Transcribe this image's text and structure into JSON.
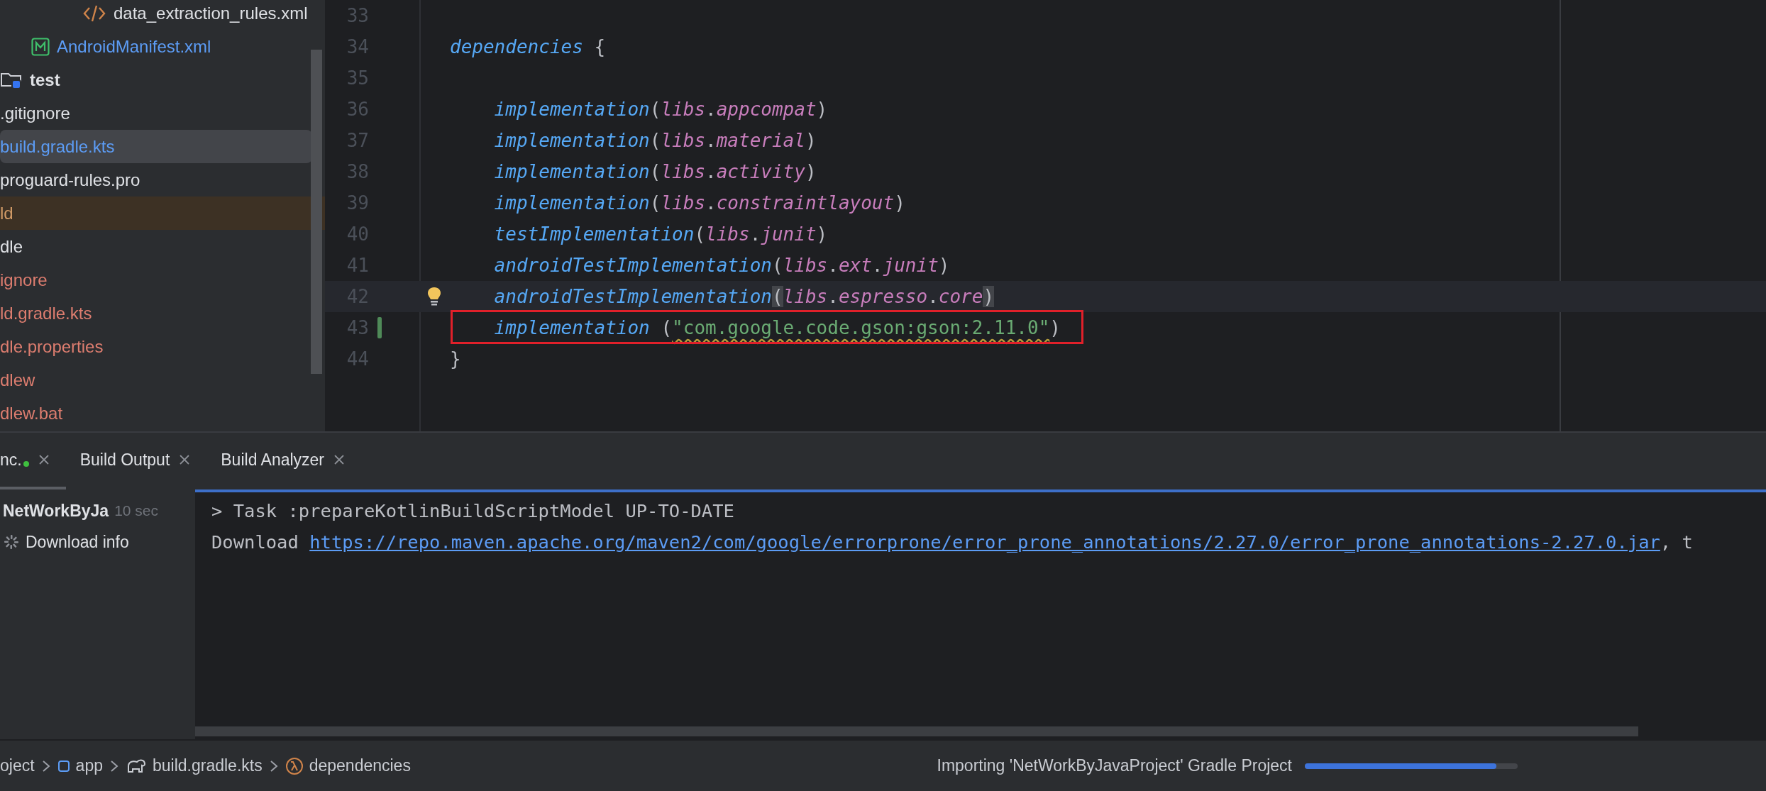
{
  "project_tree": [
    {
      "children": [
        {
          "children": [
            {
              "children": [
                {
                  "label": "data_extraction_rules.xml",
                  "kind": "xml",
                  "color": "#dfe1e5",
                  "selected": false,
                  "highlighted": false
                }
              ]
            },
            {
              "label": "AndroidManifest.xml",
              "kind": "manifest",
              "color": "#5c9cf5",
              "selected": false,
              "highlighted": false
            }
          ]
        },
        {
          "label": "test",
          "kind": "folder",
          "color": "#dfe1e5",
          "selected": false,
          "highlighted": false
        },
        {
          "label": ".gitignore",
          "color": "#dfe1e5",
          "selected": false,
          "highlighted": false
        },
        {
          "label": "build.gradle.kts",
          "color": "#5c9cf5",
          "selected": true,
          "highlighted": false
        },
        {
          "label": "proguard-rules.pro",
          "color": "#dfe1e5",
          "selected": false,
          "highlighted": false
        }
      ]
    },
    {
      "label": "ld",
      "color": "#d19a66",
      "selected": false,
      "highlighted": true
    },
    {
      "label": "dle",
      "color": "#dfe1e5",
      "selected": false,
      "highlighted": false
    },
    {
      "label": "ignore",
      "color": "#dd7d6f",
      "selected": false,
      "highlighted": false
    },
    {
      "label": "ld.gradle.kts",
      "color": "#dd7d6f",
      "selected": false,
      "highlighted": false
    },
    {
      "label": "dle.properties",
      "color": "#dd7d6f",
      "selected": false,
      "highlighted": false
    },
    {
      "label": "dlew",
      "color": "#dd7d6f",
      "selected": false,
      "highlighted": false
    },
    {
      "label": "dlew.bat",
      "color": "#dd7d6f",
      "selected": false,
      "highlighted": false
    }
  ],
  "editor": {
    "lines": [
      {
        "number": "33",
        "current": false,
        "changed": false,
        "bulb": false,
        "annotated": false
      },
      {
        "number": "34",
        "current": false,
        "changed": false,
        "bulb": false,
        "annotated": false,
        "tokens": [
          {
            "kind": "fn",
            "text": "dependencies"
          },
          {
            "kind": "plain",
            "text": " {"
          }
        ]
      },
      {
        "number": "35",
        "current": false,
        "changed": false,
        "bulb": false,
        "annotated": false
      },
      {
        "number": "36",
        "current": false,
        "changed": false,
        "bulb": false,
        "annotated": false,
        "tokens": [
          {
            "kind": "fn",
            "text": "    implementation"
          },
          {
            "kind": "plain",
            "text": "("
          },
          {
            "kind": "lib",
            "text": "libs"
          },
          {
            "kind": "plain",
            "text": "."
          },
          {
            "kind": "lib",
            "text": "appcompat"
          },
          {
            "kind": "plain",
            "text": ")"
          }
        ]
      },
      {
        "number": "37",
        "current": false,
        "changed": false,
        "bulb": false,
        "annotated": false,
        "tokens": [
          {
            "kind": "fn",
            "text": "    implementation"
          },
          {
            "kind": "plain",
            "text": "("
          },
          {
            "kind": "lib",
            "text": "libs"
          },
          {
            "kind": "plain",
            "text": "."
          },
          {
            "kind": "lib",
            "text": "material"
          },
          {
            "kind": "plain",
            "text": ")"
          }
        ]
      },
      {
        "number": "38",
        "current": false,
        "changed": false,
        "bulb": false,
        "annotated": false,
        "tokens": [
          {
            "kind": "fn",
            "text": "    implementation"
          },
          {
            "kind": "plain",
            "text": "("
          },
          {
            "kind": "lib",
            "text": "libs"
          },
          {
            "kind": "plain",
            "text": "."
          },
          {
            "kind": "lib",
            "text": "activity"
          },
          {
            "kind": "plain",
            "text": ")"
          }
        ]
      },
      {
        "number": "39",
        "current": false,
        "changed": false,
        "bulb": false,
        "annotated": false,
        "tokens": [
          {
            "kind": "fn",
            "text": "    implementation"
          },
          {
            "kind": "plain",
            "text": "("
          },
          {
            "kind": "lib",
            "text": "libs"
          },
          {
            "kind": "plain",
            "text": "."
          },
          {
            "kind": "lib",
            "text": "constraintlayout"
          },
          {
            "kind": "plain",
            "text": ")"
          }
        ]
      },
      {
        "number": "40",
        "current": false,
        "changed": false,
        "bulb": false,
        "annotated": false,
        "tokens": [
          {
            "kind": "fn",
            "text": "    testImplementation"
          },
          {
            "kind": "plain",
            "text": "("
          },
          {
            "kind": "lib",
            "text": "libs"
          },
          {
            "kind": "plain",
            "text": "."
          },
          {
            "kind": "lib",
            "text": "junit"
          },
          {
            "kind": "plain",
            "text": ")"
          }
        ]
      },
      {
        "number": "41",
        "current": false,
        "changed": false,
        "bulb": false,
        "annotated": false,
        "tokens": [
          {
            "kind": "fn",
            "text": "    androidTestImplementation"
          },
          {
            "kind": "plain",
            "text": "("
          },
          {
            "kind": "lib",
            "text": "libs"
          },
          {
            "kind": "plain",
            "text": "."
          },
          {
            "kind": "lib",
            "text": "ext"
          },
          {
            "kind": "plain",
            "text": "."
          },
          {
            "kind": "lib",
            "text": "junit"
          },
          {
            "kind": "plain",
            "text": ")"
          }
        ]
      },
      {
        "number": "42",
        "current": true,
        "changed": false,
        "bulb": true,
        "annotated": false,
        "tokens": [
          {
            "kind": "fn",
            "text": "    androidTestImplementation"
          },
          {
            "kind": "brace",
            "text": "("
          },
          {
            "kind": "lib",
            "text": "libs"
          },
          {
            "kind": "plain",
            "text": "."
          },
          {
            "kind": "lib",
            "text": "espresso"
          },
          {
            "kind": "plain",
            "text": "."
          },
          {
            "kind": "lib",
            "text": "core"
          },
          {
            "kind": "brace",
            "text": ")"
          }
        ]
      },
      {
        "number": "43",
        "current": false,
        "changed": true,
        "bulb": false,
        "annotated": true,
        "tokens": [
          {
            "kind": "fn",
            "text": "    implementation"
          },
          {
            "kind": "plain",
            "text": " ("
          },
          {
            "kind": "warn_str",
            "text": "\"com.google.code.gson:gson:2.11.0\""
          },
          {
            "kind": "plain",
            "text": ")"
          }
        ]
      },
      {
        "number": "44",
        "current": false,
        "changed": false,
        "bulb": false,
        "annotated": false,
        "tokens": [
          {
            "kind": "plain",
            "text": "}"
          }
        ]
      }
    ]
  },
  "bottom_tabs": [
    {
      "label": "nc.",
      "selected": true,
      "status_dot": true
    },
    {
      "label": "Build Output",
      "selected": false,
      "status_dot": false
    },
    {
      "label": "Build Analyzer",
      "selected": false,
      "status_dot": false
    }
  ],
  "build_tree": [
    {
      "label": "NetWorkByJa",
      "time": "10 sec",
      "kind": "root"
    },
    {
      "label": "Download info",
      "kind": "running"
    }
  ],
  "console": [
    [
      {
        "kind": "text",
        "text": "> Task :prepareKotlinBuildScriptModel UP-TO-DATE"
      }
    ],
    [
      {
        "kind": "text",
        "text": "Download "
      },
      {
        "kind": "link",
        "text": "https://repo.maven.apache.org/maven2/com/google/errorprone/error_prone_annotations/2.27.0/error_prone_annotations-2.27.0.jar"
      },
      {
        "kind": "text",
        "text": ", t"
      }
    ]
  ],
  "status_bar": {
    "breadcrumbs": [
      {
        "label": "oject"
      },
      {
        "label": "app",
        "kind": "module"
      },
      {
        "label": "build.gradle.kts",
        "kind": "gradle"
      },
      {
        "label": "dependencies",
        "kind": "lambda"
      }
    ],
    "progress": {
      "label": "Importing 'NetWorkByJavaProject' Gradle Project",
      "level": 0.9
    }
  }
}
